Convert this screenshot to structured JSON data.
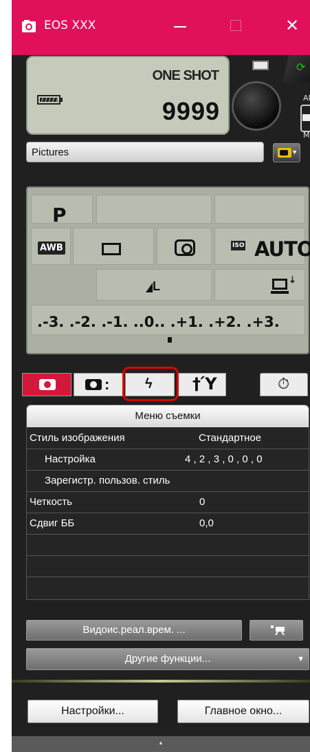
{
  "window": {
    "title": "EOS XXX",
    "min_glyph": "—",
    "close_glyph": "✕"
  },
  "top_lcd": {
    "af_mode": "ONE SHOT",
    "shots_remaining": "9999"
  },
  "af_switch": {
    "af": "AF",
    "mf": "MF"
  },
  "folder": {
    "name": "Pictures"
  },
  "main_lcd": {
    "mode": "P",
    "white_balance": "AWB",
    "iso_badge": "ISO",
    "iso": "AUTO",
    "quality": "L",
    "exposure_scale": ".-3. .-2. .-1. ..0.. .+1. .+2. .+3."
  },
  "tabs": [
    {
      "name": "shooting-menu-1",
      "active": true
    },
    {
      "name": "shooting-menu-2",
      "active": false
    },
    {
      "name": "flash",
      "active": false,
      "highlighted": true
    },
    {
      "name": "setup",
      "active": false
    },
    {
      "name": "timer",
      "active": false
    }
  ],
  "menu": {
    "title": "Меню съемки",
    "rows": [
      {
        "label": "Стиль изображения",
        "value": "Стандартное"
      },
      {
        "label": "Настройка",
        "value": "4 , 2 , 3 , 0 , 0 , 0"
      },
      {
        "label": "Зарегистр. пользов. стиль",
        "value": ""
      },
      {
        "label": "Четкость",
        "value": "0"
      },
      {
        "label": "Сдвиг ББ",
        "value": "0,0"
      },
      {
        "label": "",
        "value": ""
      },
      {
        "label": "",
        "value": ""
      }
    ]
  },
  "buttons": {
    "live_view": "Видоис.реал.врем. ...",
    "other_functions": "Другие функции...",
    "other_arrow": "▼",
    "settings": "Настройки...",
    "main_window": "Главное окно...",
    "collapse_arrow": "▲"
  },
  "colors": {
    "titlebar": "#e0105a",
    "active_tab": "#d11a3a",
    "highlight": "#e00000",
    "lcd": "#aab0a2"
  }
}
